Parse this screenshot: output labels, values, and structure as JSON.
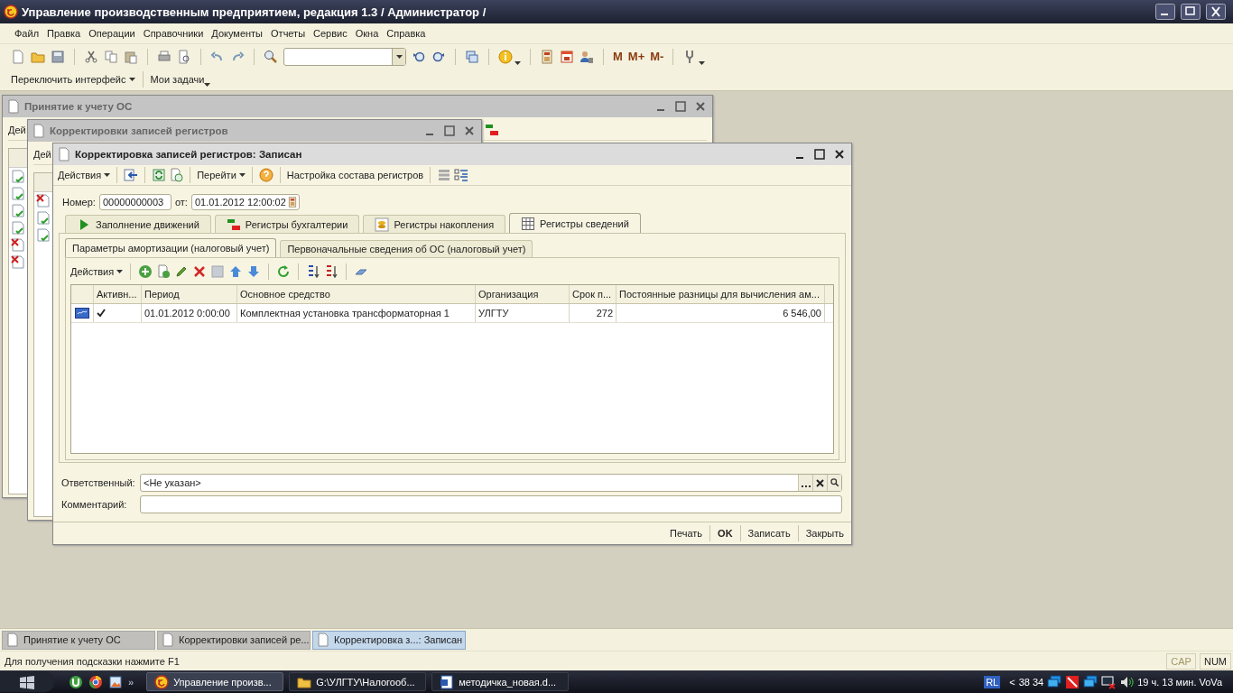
{
  "app_title": "Управление производственным предприятием, редакция 1.3 / Администратор /",
  "menu": [
    "Файл",
    "Правка",
    "Операции",
    "Справочники",
    "Документы",
    "Отчеты",
    "Сервис",
    "Окна",
    "Справка"
  ],
  "memory_buttons": [
    "М",
    "М+",
    "М-"
  ],
  "toolbar2": [
    "Переключить интерфейс",
    "Мои задачи"
  ],
  "windows": [
    {
      "title": "Принятие к учету ОС",
      "toolbar_text": "Дей",
      "rows": [
        {
          "kind": "posted"
        },
        {
          "kind": "posted"
        },
        {
          "kind": "posted"
        },
        {
          "kind": "posted"
        },
        {
          "kind": "deleted"
        },
        {
          "kind": "deleted"
        }
      ]
    },
    {
      "title": "Корректировки записей регистров",
      "toolbar_text": "Дей",
      "rows": [
        {
          "kind": "deleted"
        },
        {
          "kind": "posted"
        },
        {
          "kind": "posted"
        }
      ]
    }
  ],
  "document": {
    "title": "Корректировка записей регистров: Записан",
    "toolbar": [
      "Действия",
      "Перейти",
      "Настройка состава регистров"
    ],
    "number_label": "Номер:",
    "number": "00000000003",
    "date_label": "от:",
    "date": "01.01.2012 12:00:02",
    "tabs": [
      {
        "label": "Заполнение движений",
        "kind": "play",
        "selected": false
      },
      {
        "label": "Регистры бухгалтерии",
        "kind": "dtkt",
        "selected": false
      },
      {
        "label": "Регистры накопления",
        "kind": "coins",
        "selected": false
      },
      {
        "label": "Регистры сведений",
        "kind": "table",
        "selected": true
      }
    ],
    "subtabs": [
      {
        "label": "Параметры амортизации (налоговый учет)",
        "selected": true
      },
      {
        "label": "Первоначальные сведения об ОС (налоговый учет)",
        "selected": false
      }
    ],
    "table_toolbar": "Действия",
    "columns": [
      "Активн...",
      "Период",
      "Основное средство",
      "Организация",
      "Срок п...",
      "Постоянные разницы для вычисления ам..."
    ],
    "rows": [
      {
        "active": true,
        "period": "01.01.2012 0:00:00",
        "asset": "Комплектная установка трансформаторная 1",
        "organization": "УЛГТУ",
        "term": "272",
        "differences": "6 546,00"
      }
    ],
    "responsible_label": "Ответственный:",
    "responsible": "<Не указан>",
    "comment_label": "Комментарий:",
    "buttons": [
      {
        "label": "Печать",
        "bold": false
      },
      {
        "label": "OK",
        "bold": true
      },
      {
        "label": "Записать",
        "bold": false
      },
      {
        "label": "Закрыть",
        "bold": false
      }
    ]
  },
  "window_tabs": [
    {
      "label": "Принятие к учету ОС",
      "selected": false
    },
    {
      "label": "Корректировки записей ре...",
      "selected": false
    },
    {
      "label": "Корректировка з...: Записан",
      "selected": true
    }
  ],
  "status": {
    "hint": "Для получения подсказки нажмите F1",
    "indicators": [
      {
        "label": "CAP",
        "on": false
      },
      {
        "label": "NUM",
        "on": true
      }
    ]
  },
  "taskbar": {
    "more": "»",
    "tasks": [
      {
        "label": "Управление произв...",
        "kind": "onec",
        "selected": true
      },
      {
        "label": "G:\\УЛГТУ\\Налогооб...",
        "kind": "folder",
        "selected": false
      },
      {
        "label": "методичка_новая.d...",
        "kind": "word",
        "selected": false
      }
    ],
    "language": "RL",
    "expand": "<",
    "tray_text": "38 34",
    "clock": "19 ч. 13 мин. VoVa"
  }
}
